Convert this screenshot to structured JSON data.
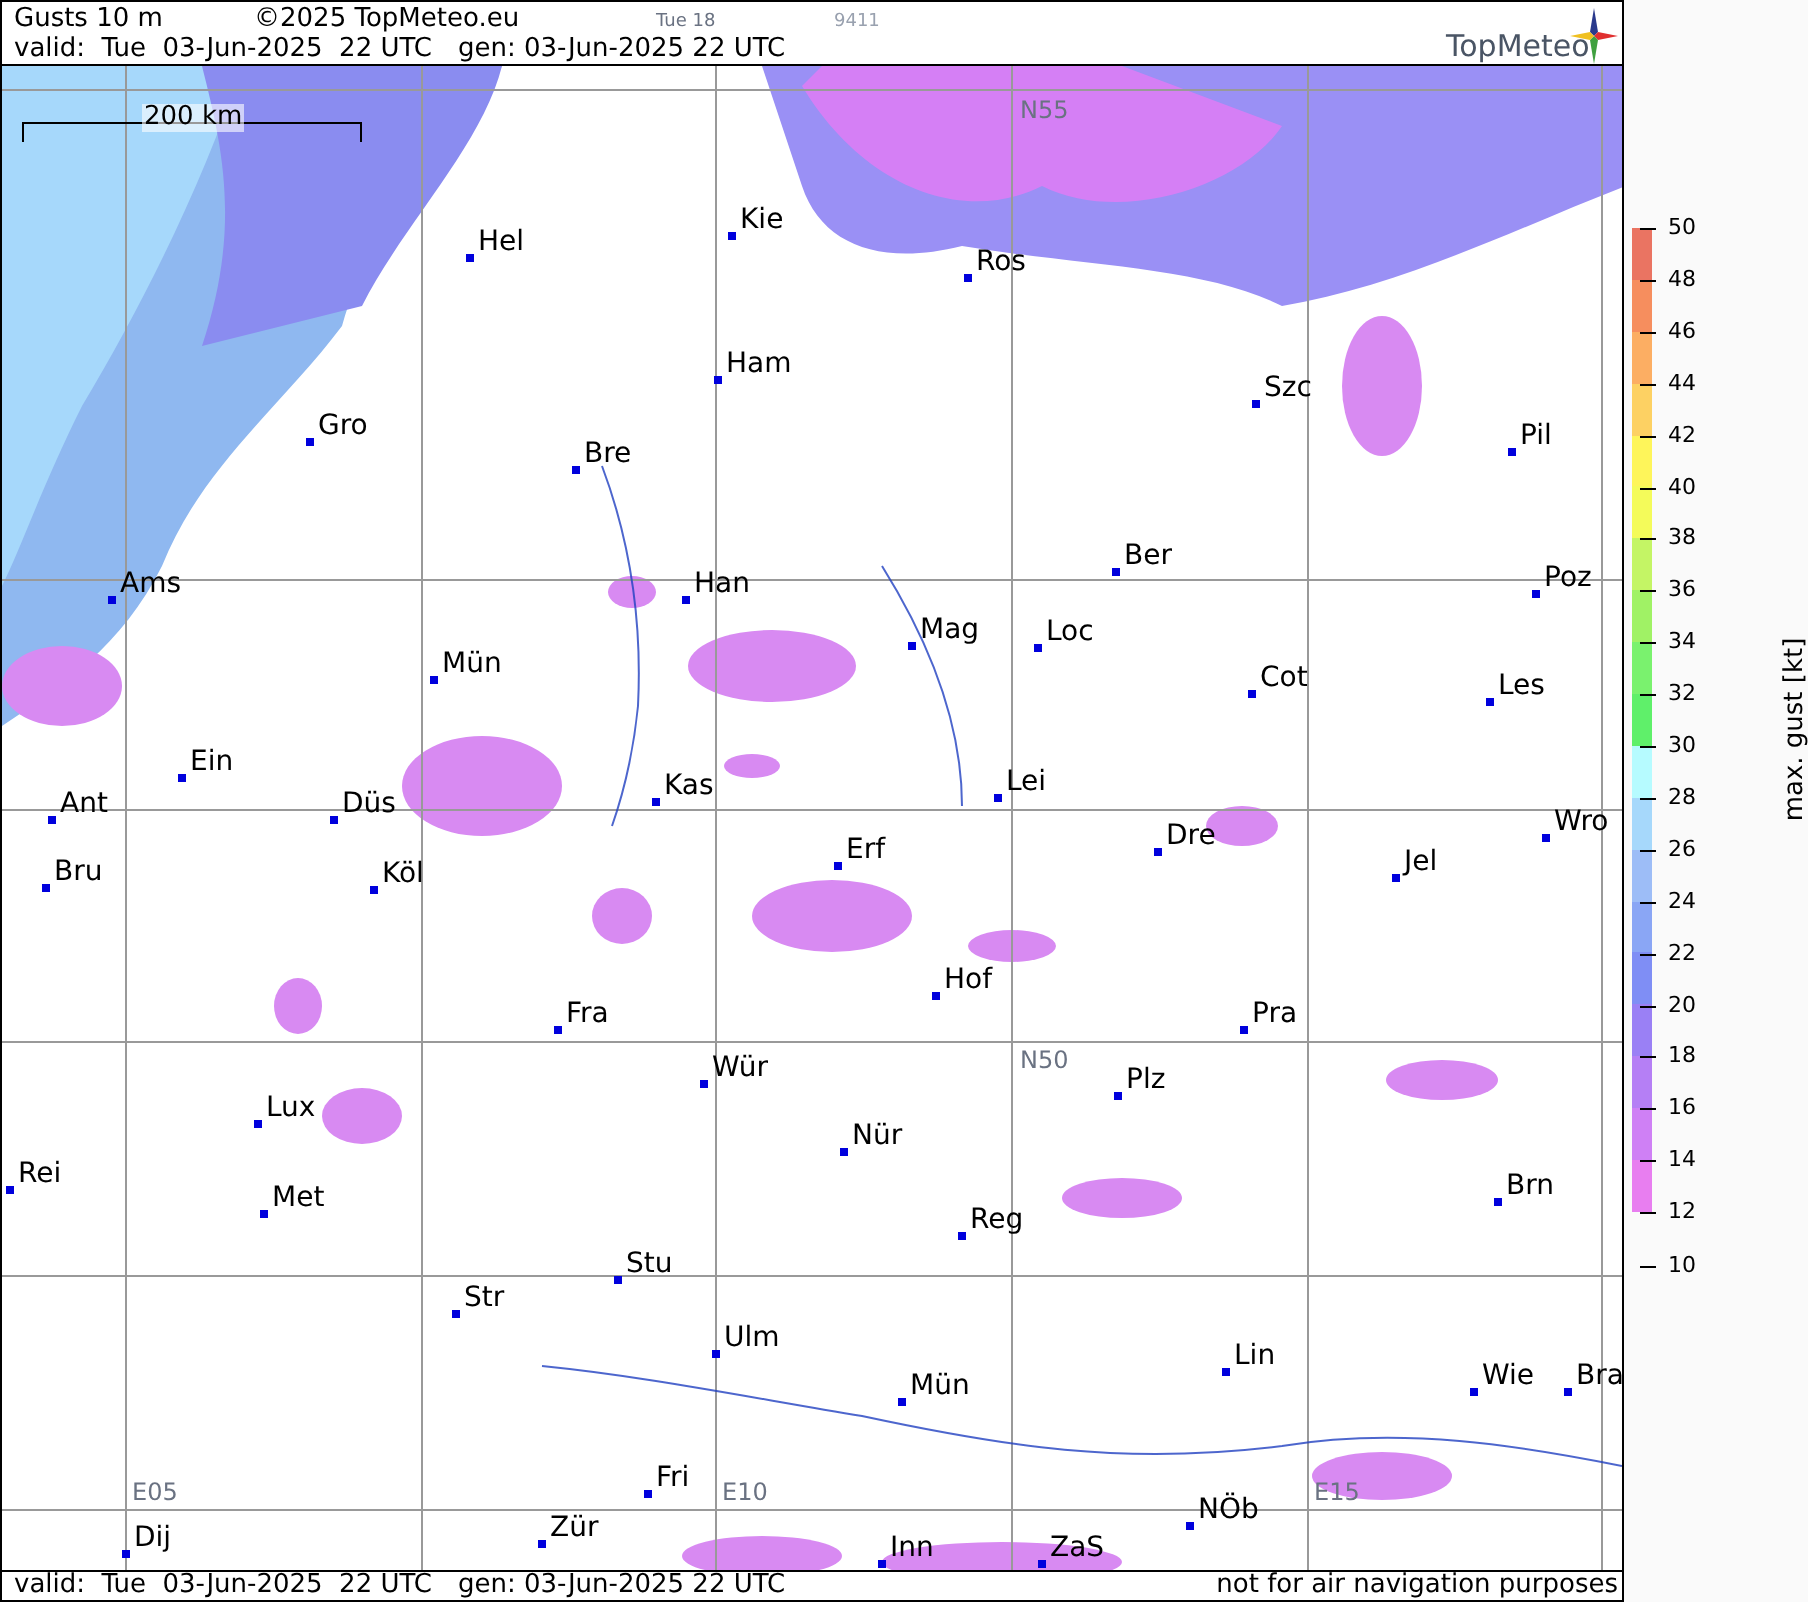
{
  "header": {
    "title": "Gusts 10 m",
    "copyright": "©2025 TopMeteo.eu",
    "run": "Tue 18",
    "code": "9411",
    "valid": "valid:  Tue  03-Jun-2025  22 UTC",
    "generated": "gen: 03-Jun-2025 22 UTC",
    "logo": "TopMeteo"
  },
  "map": {
    "scale": "200 km",
    "grid_labels": [
      "N55",
      "N50",
      "E05",
      "E10",
      "E15"
    ],
    "cities": [
      "Hel",
      "Kie",
      "Ros",
      "Ham",
      "Szc",
      "Gro",
      "Bre",
      "Pil",
      "Ber",
      "Ams",
      "Han",
      "Mag",
      "Loc",
      "Poz",
      "Mün",
      "Cot",
      "Les",
      "Ein",
      "Kas",
      "Lei",
      "Ant",
      "Düs",
      "Dre",
      "Wro",
      "Erf",
      "Bru",
      "Köl",
      "Jel",
      "Hof",
      "Fra",
      "Pra",
      "Wür",
      "Plz",
      "Lux",
      "Nür",
      "Rei",
      "Met",
      "Reg",
      "Brn",
      "Stu",
      "Str",
      "Ulm",
      "Lin",
      "Wie",
      "Bra",
      "Mün",
      "Fri",
      "NÖb",
      "Dij",
      "Zür",
      "Inn",
      "ZaS"
    ]
  },
  "footer": {
    "valid": "valid:  Tue  03-Jun-2025  22 UTC",
    "generated": "gen: 03-Jun-2025 22 UTC",
    "note": "not for air navigation purposes"
  },
  "legend": {
    "title": "max. gust [kt]",
    "ticks": [
      "50",
      "48",
      "46",
      "44",
      "42",
      "40",
      "38",
      "36",
      "34",
      "32",
      "30",
      "28",
      "26",
      "24",
      "22",
      "20",
      "18",
      "16",
      "14",
      "12",
      "10"
    ],
    "bands": [
      {
        "color": "#ea7462"
      },
      {
        "color": "#f68e5e"
      },
      {
        "color": "#fcae63"
      },
      {
        "color": "#fdd163"
      },
      {
        "color": "#fef55a"
      },
      {
        "color": "#f4fb5a"
      },
      {
        "color": "#c4f565"
      },
      {
        "color": "#a0f265"
      },
      {
        "color": "#7af26e"
      },
      {
        "color": "#5ff06a"
      },
      {
        "color": "#b6fbff"
      },
      {
        "color": "#a6d8fb"
      },
      {
        "color": "#9dbdf7"
      },
      {
        "color": "#8aa6f5"
      },
      {
        "color": "#7f8ef5"
      },
      {
        "color": "#9a80f5"
      },
      {
        "color": "#b57ff5"
      },
      {
        "color": "#cf80f5"
      },
      {
        "color": "#e87ef0"
      }
    ]
  }
}
